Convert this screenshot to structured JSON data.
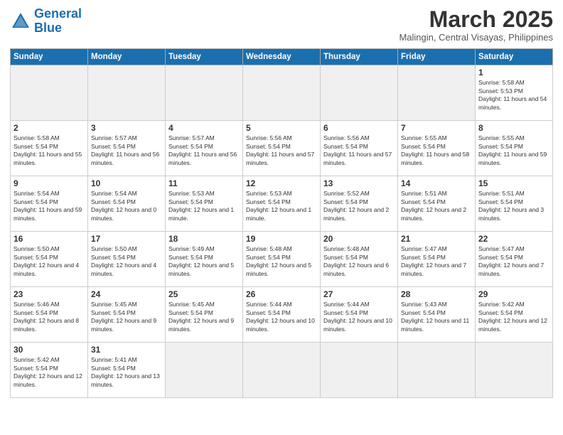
{
  "logo": {
    "text_general": "General",
    "text_blue": "Blue"
  },
  "title": {
    "month_year": "March 2025",
    "location": "Malingin, Central Visayas, Philippines"
  },
  "days_of_week": [
    "Sunday",
    "Monday",
    "Tuesday",
    "Wednesday",
    "Thursday",
    "Friday",
    "Saturday"
  ],
  "weeks": [
    [
      {
        "day": "",
        "empty": true
      },
      {
        "day": "",
        "empty": true
      },
      {
        "day": "",
        "empty": true
      },
      {
        "day": "",
        "empty": true
      },
      {
        "day": "",
        "empty": true
      },
      {
        "day": "",
        "empty": true
      },
      {
        "day": "1",
        "sunrise": "5:58 AM",
        "sunset": "5:53 PM",
        "daylight": "11 hours and 54 minutes."
      }
    ],
    [
      {
        "day": "2",
        "sunrise": "5:58 AM",
        "sunset": "5:54 PM",
        "daylight": "11 hours and 55 minutes."
      },
      {
        "day": "3",
        "sunrise": "5:57 AM",
        "sunset": "5:54 PM",
        "daylight": "11 hours and 56 minutes."
      },
      {
        "day": "4",
        "sunrise": "5:57 AM",
        "sunset": "5:54 PM",
        "daylight": "11 hours and 56 minutes."
      },
      {
        "day": "5",
        "sunrise": "5:56 AM",
        "sunset": "5:54 PM",
        "daylight": "11 hours and 57 minutes."
      },
      {
        "day": "6",
        "sunrise": "5:56 AM",
        "sunset": "5:54 PM",
        "daylight": "11 hours and 57 minutes."
      },
      {
        "day": "7",
        "sunrise": "5:55 AM",
        "sunset": "5:54 PM",
        "daylight": "11 hours and 58 minutes."
      },
      {
        "day": "8",
        "sunrise": "5:55 AM",
        "sunset": "5:54 PM",
        "daylight": "11 hours and 59 minutes."
      }
    ],
    [
      {
        "day": "9",
        "sunrise": "5:54 AM",
        "sunset": "5:54 PM",
        "daylight": "11 hours and 59 minutes."
      },
      {
        "day": "10",
        "sunrise": "5:54 AM",
        "sunset": "5:54 PM",
        "daylight": "12 hours and 0 minutes."
      },
      {
        "day": "11",
        "sunrise": "5:53 AM",
        "sunset": "5:54 PM",
        "daylight": "12 hours and 1 minute."
      },
      {
        "day": "12",
        "sunrise": "5:53 AM",
        "sunset": "5:54 PM",
        "daylight": "12 hours and 1 minute."
      },
      {
        "day": "13",
        "sunrise": "5:52 AM",
        "sunset": "5:54 PM",
        "daylight": "12 hours and 2 minutes."
      },
      {
        "day": "14",
        "sunrise": "5:51 AM",
        "sunset": "5:54 PM",
        "daylight": "12 hours and 2 minutes."
      },
      {
        "day": "15",
        "sunrise": "5:51 AM",
        "sunset": "5:54 PM",
        "daylight": "12 hours and 3 minutes."
      }
    ],
    [
      {
        "day": "16",
        "sunrise": "5:50 AM",
        "sunset": "5:54 PM",
        "daylight": "12 hours and 4 minutes."
      },
      {
        "day": "17",
        "sunrise": "5:50 AM",
        "sunset": "5:54 PM",
        "daylight": "12 hours and 4 minutes."
      },
      {
        "day": "18",
        "sunrise": "5:49 AM",
        "sunset": "5:54 PM",
        "daylight": "12 hours and 5 minutes."
      },
      {
        "day": "19",
        "sunrise": "5:48 AM",
        "sunset": "5:54 PM",
        "daylight": "12 hours and 5 minutes."
      },
      {
        "day": "20",
        "sunrise": "5:48 AM",
        "sunset": "5:54 PM",
        "daylight": "12 hours and 6 minutes."
      },
      {
        "day": "21",
        "sunrise": "5:47 AM",
        "sunset": "5:54 PM",
        "daylight": "12 hours and 7 minutes."
      },
      {
        "day": "22",
        "sunrise": "5:47 AM",
        "sunset": "5:54 PM",
        "daylight": "12 hours and 7 minutes."
      }
    ],
    [
      {
        "day": "23",
        "sunrise": "5:46 AM",
        "sunset": "5:54 PM",
        "daylight": "12 hours and 8 minutes."
      },
      {
        "day": "24",
        "sunrise": "5:45 AM",
        "sunset": "5:54 PM",
        "daylight": "12 hours and 9 minutes."
      },
      {
        "day": "25",
        "sunrise": "5:45 AM",
        "sunset": "5:54 PM",
        "daylight": "12 hours and 9 minutes."
      },
      {
        "day": "26",
        "sunrise": "5:44 AM",
        "sunset": "5:54 PM",
        "daylight": "12 hours and 10 minutes."
      },
      {
        "day": "27",
        "sunrise": "5:44 AM",
        "sunset": "5:54 PM",
        "daylight": "12 hours and 10 minutes."
      },
      {
        "day": "28",
        "sunrise": "5:43 AM",
        "sunset": "5:54 PM",
        "daylight": "12 hours and 11 minutes."
      },
      {
        "day": "29",
        "sunrise": "5:42 AM",
        "sunset": "5:54 PM",
        "daylight": "12 hours and 12 minutes."
      }
    ],
    [
      {
        "day": "30",
        "sunrise": "5:42 AM",
        "sunset": "5:54 PM",
        "daylight": "12 hours and 12 minutes."
      },
      {
        "day": "31",
        "sunrise": "5:41 AM",
        "sunset": "5:54 PM",
        "daylight": "12 hours and 13 minutes."
      },
      {
        "day": "",
        "empty": true
      },
      {
        "day": "",
        "empty": true
      },
      {
        "day": "",
        "empty": true
      },
      {
        "day": "",
        "empty": true
      },
      {
        "day": "",
        "empty": true
      }
    ]
  ]
}
